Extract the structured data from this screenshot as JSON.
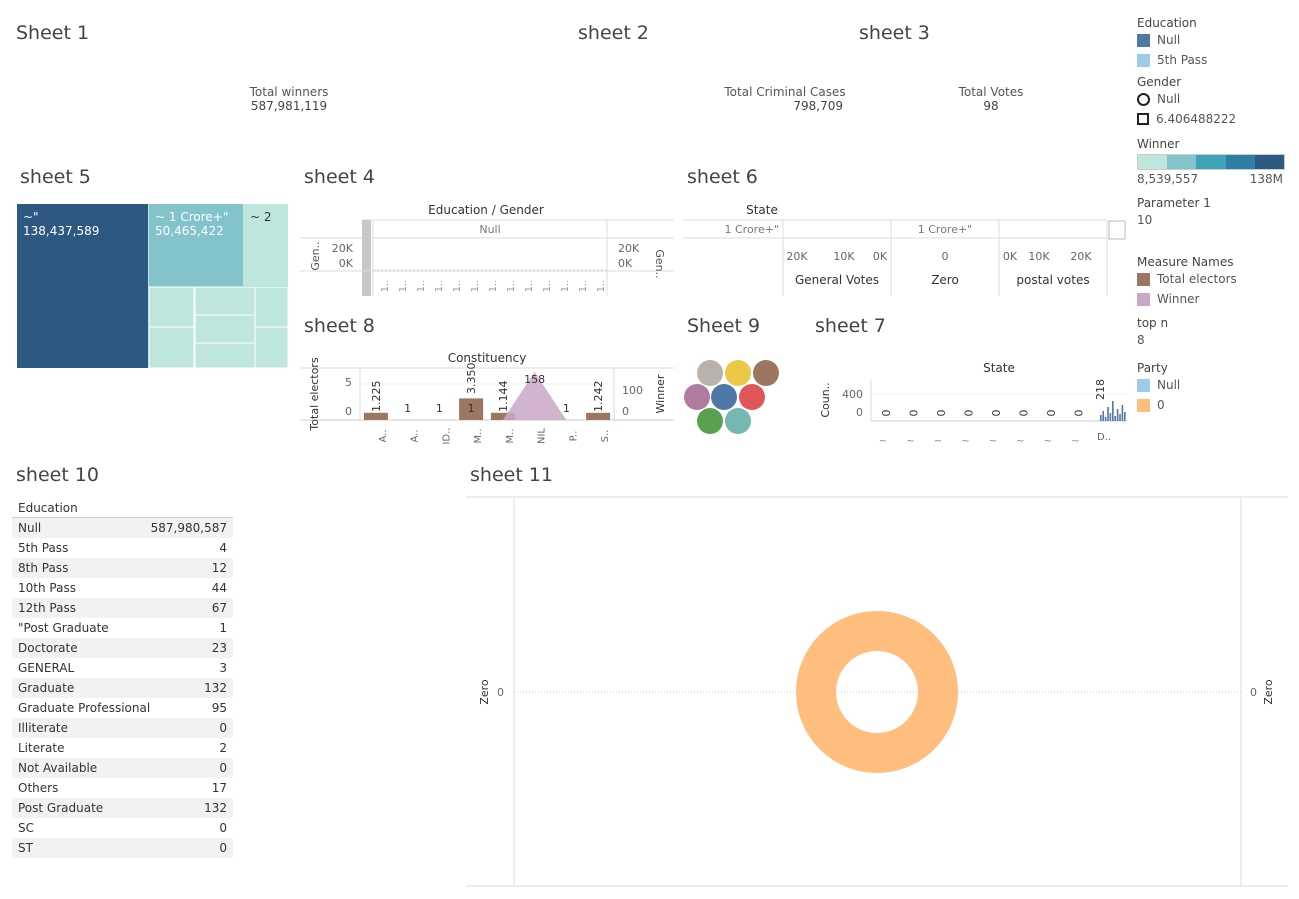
{
  "sheet1": {
    "title": "Sheet 1",
    "kpi_label": "Total winners",
    "kpi_value": "587,981,119"
  },
  "sheet2": {
    "title": "sheet 2"
  },
  "sheet3": {
    "title": "sheet 3",
    "kpi1_label": "Total Criminal Cases",
    "kpi1_value": "798,709",
    "kpi2_label": "Total Votes",
    "kpi2_value": "98"
  },
  "sheet5": {
    "title": "sheet 5",
    "cells": [
      {
        "label": "~\"",
        "value": "138,437,589"
      },
      {
        "label": "~ 1 Crore+\"",
        "value": "50,465,422"
      },
      {
        "label": "~ 2",
        "value": ""
      }
    ],
    "colors": {
      "dark": "#2c5882",
      "mid": "#82c3cc",
      "light": "#bfe6dd"
    }
  },
  "sheet4": {
    "title": "sheet 4",
    "header": "Education / Gender",
    "col": "Null",
    "left_axis": "Gen..",
    "right_axis": "Gen..",
    "ticks": [
      "20K",
      "0K"
    ],
    "x_labels": [
      "1..",
      "1..",
      "1..",
      "1..",
      "1..",
      "1..",
      "1..",
      "1..",
      "1..",
      "1..",
      "1..",
      "1..",
      "1.."
    ]
  },
  "sheet6": {
    "title": "sheet 6",
    "header": "State",
    "row_label": "1 Crore+\"",
    "mid_label": "1 Crore+\"",
    "left_ticks": [
      "20K",
      "10K",
      "0K"
    ],
    "mid_tick": "0",
    "right_ticks": [
      "0K",
      "10K",
      "20K"
    ],
    "cols": [
      "General Votes",
      "Zero",
      "postal votes"
    ]
  },
  "sheet8": {
    "title": "sheet 8",
    "header": "Constituency",
    "left_axis": "Total electors",
    "right_axis": "Winner",
    "left_ticks": [
      "5",
      "0"
    ],
    "right_ticks": [
      "100",
      "0"
    ],
    "chart_data": {
      "type": "bar",
      "categories": [
        "A..",
        "A..",
        "ID..",
        "M..",
        "M..",
        "NIL",
        "P..",
        "S.."
      ],
      "series": [
        {
          "name": "Total electors",
          "values": [
            1,
            0,
            0,
            3,
            1,
            0,
            0,
            1
          ],
          "labels": [
            "1.225",
            "1",
            "1",
            "1",
            "1.144",
            "",
            "1",
            "1.242"
          ]
        },
        {
          "name": "Winner",
          "values": [
            0,
            0,
            0,
            0,
            0,
            158,
            0,
            0
          ]
        }
      ],
      "annotations": [
        "3.350",
        "158"
      ],
      "colors": [
        "#9c7660",
        "#c9a8c6"
      ]
    }
  },
  "sheet9": {
    "title": "Sheet 9",
    "circles": [
      "#bab0ac",
      "#ecc846",
      "#9c7660",
      "#b07aa1",
      "#4e79a7",
      "#e15759",
      "#59a14f",
      "#76b7b2"
    ]
  },
  "sheet7": {
    "title": "sheet 7",
    "header": "State",
    "axis": "Coun..",
    "ticks": [
      "400",
      "0"
    ],
    "zero_labels": [
      "0",
      "0",
      "0",
      "0",
      "0",
      "0",
      "0",
      "0"
    ],
    "peak_label": "218",
    "last_x": "D.."
  },
  "legend": {
    "education": {
      "title": "Education",
      "items": [
        {
          "label": "Null",
          "color": "#4e79a7"
        },
        {
          "label": "5th Pass",
          "color": "#a0cbe8"
        }
      ]
    },
    "gender": {
      "title": "Gender",
      "items": [
        {
          "label": "Null",
          "shape": "circle"
        },
        {
          "label": "6.406488222",
          "shape": "square"
        }
      ]
    },
    "winner": {
      "title": "Winner",
      "min": "8,539,557",
      "max": "138M",
      "colors": [
        "#bfe6dd",
        "#82c3cc",
        "#3fa3b8",
        "#2d7fa6",
        "#2c5882"
      ]
    },
    "parameter1": {
      "title": "Parameter 1",
      "value": "10"
    },
    "measure_names": {
      "title": "Measure Names",
      "items": [
        {
          "label": "Total electors",
          "color": "#9c7660"
        },
        {
          "label": "Winner",
          "color": "#c9a8c6"
        }
      ]
    },
    "top_n": {
      "title": "top n",
      "value": "8"
    },
    "party": {
      "title": "Party",
      "items": [
        {
          "label": "Null",
          "color": "#a0cbe8"
        },
        {
          "label": "0",
          "color": "#ffbe7d"
        }
      ]
    }
  },
  "sheet10": {
    "title": "sheet 10",
    "header": "Education",
    "rows": [
      {
        "label": "Null",
        "value": "587,980,587"
      },
      {
        "label": "5th Pass",
        "value": "4"
      },
      {
        "label": "8th Pass",
        "value": "12"
      },
      {
        "label": "10th Pass",
        "value": "44"
      },
      {
        "label": "12th Pass",
        "value": "67"
      },
      {
        "label": "\"Post Graduate",
        "value": "1"
      },
      {
        "label": "Doctorate",
        "value": "23"
      },
      {
        "label": "GENERAL",
        "value": "3"
      },
      {
        "label": "Graduate",
        "value": "132"
      },
      {
        "label": "Graduate Professional",
        "value": "95"
      },
      {
        "label": "Illiterate",
        "value": "0"
      },
      {
        "label": "Literate",
        "value": "2"
      },
      {
        "label": "Not Available",
        "value": "0"
      },
      {
        "label": "Others",
        "value": "17"
      },
      {
        "label": "Post Graduate",
        "value": "132"
      },
      {
        "label": "SC",
        "value": "0"
      },
      {
        "label": "ST",
        "value": "0"
      }
    ]
  },
  "sheet11": {
    "title": "sheet 11",
    "left_axis": "Zero",
    "right_axis": "Zero",
    "left_tick": "0",
    "right_tick": "0",
    "ring_color": "#ffbe7d"
  }
}
